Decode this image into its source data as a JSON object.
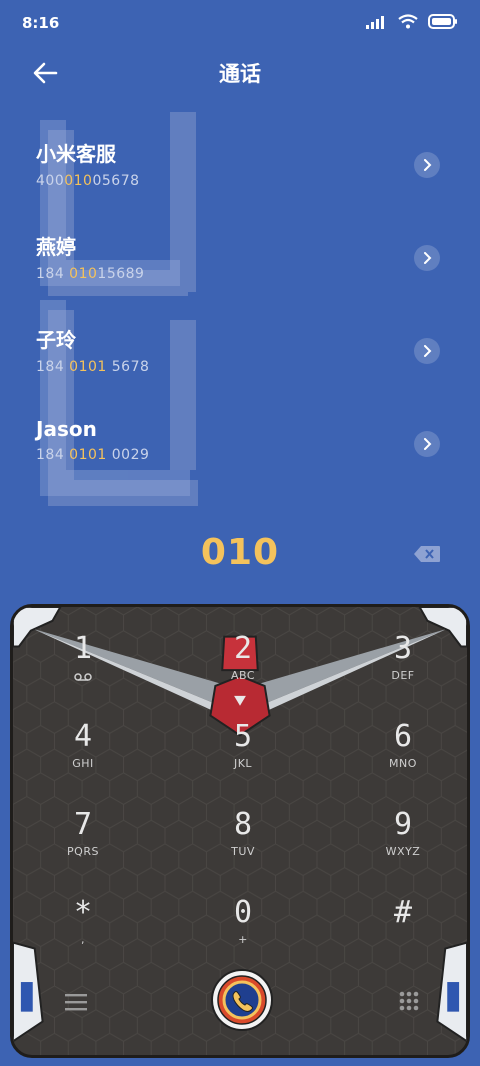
{
  "status": {
    "time": "8:16"
  },
  "header": {
    "title": "通话"
  },
  "contacts": [
    {
      "name": "小米客服",
      "num_pre": "400",
      "num_hl": "010",
      "num_post": "05678"
    },
    {
      "name": "燕婷",
      "num_pre": "184 ",
      "num_hl": "010",
      "num_post": "15689"
    },
    {
      "name": "子玲",
      "num_pre": "184 ",
      "num_hl": "0101",
      "num_post": " 5678"
    },
    {
      "name": "Jason",
      "num_pre": "184 ",
      "num_hl": "0101",
      "num_post": " 0029"
    }
  ],
  "dial": {
    "input": "010"
  },
  "keys": [
    {
      "digit": "1",
      "letters": ""
    },
    {
      "digit": "2",
      "letters": "ABC"
    },
    {
      "digit": "3",
      "letters": "DEF"
    },
    {
      "digit": "4",
      "letters": "GHI"
    },
    {
      "digit": "5",
      "letters": "JKL"
    },
    {
      "digit": "6",
      "letters": "MNO"
    },
    {
      "digit": "7",
      "letters": "PQRS"
    },
    {
      "digit": "8",
      "letters": "TUV"
    },
    {
      "digit": "9",
      "letters": "WXYZ"
    },
    {
      "digit": "*",
      "letters": ","
    },
    {
      "digit": "0",
      "letters": "+"
    },
    {
      "digit": "#",
      "letters": ""
    }
  ],
  "icons": {
    "back": "arrow-left-icon",
    "chevron": "chevron-right-icon",
    "backspace": "backspace-icon",
    "voicemail": "voicemail-icon",
    "menu": "menu-icon",
    "call": "phone-icon",
    "keypad_toggle": "dialpad-icon"
  },
  "colors": {
    "background": "#3d63b3",
    "accent": "#f4c25c",
    "keypad": "#3d3a38"
  }
}
